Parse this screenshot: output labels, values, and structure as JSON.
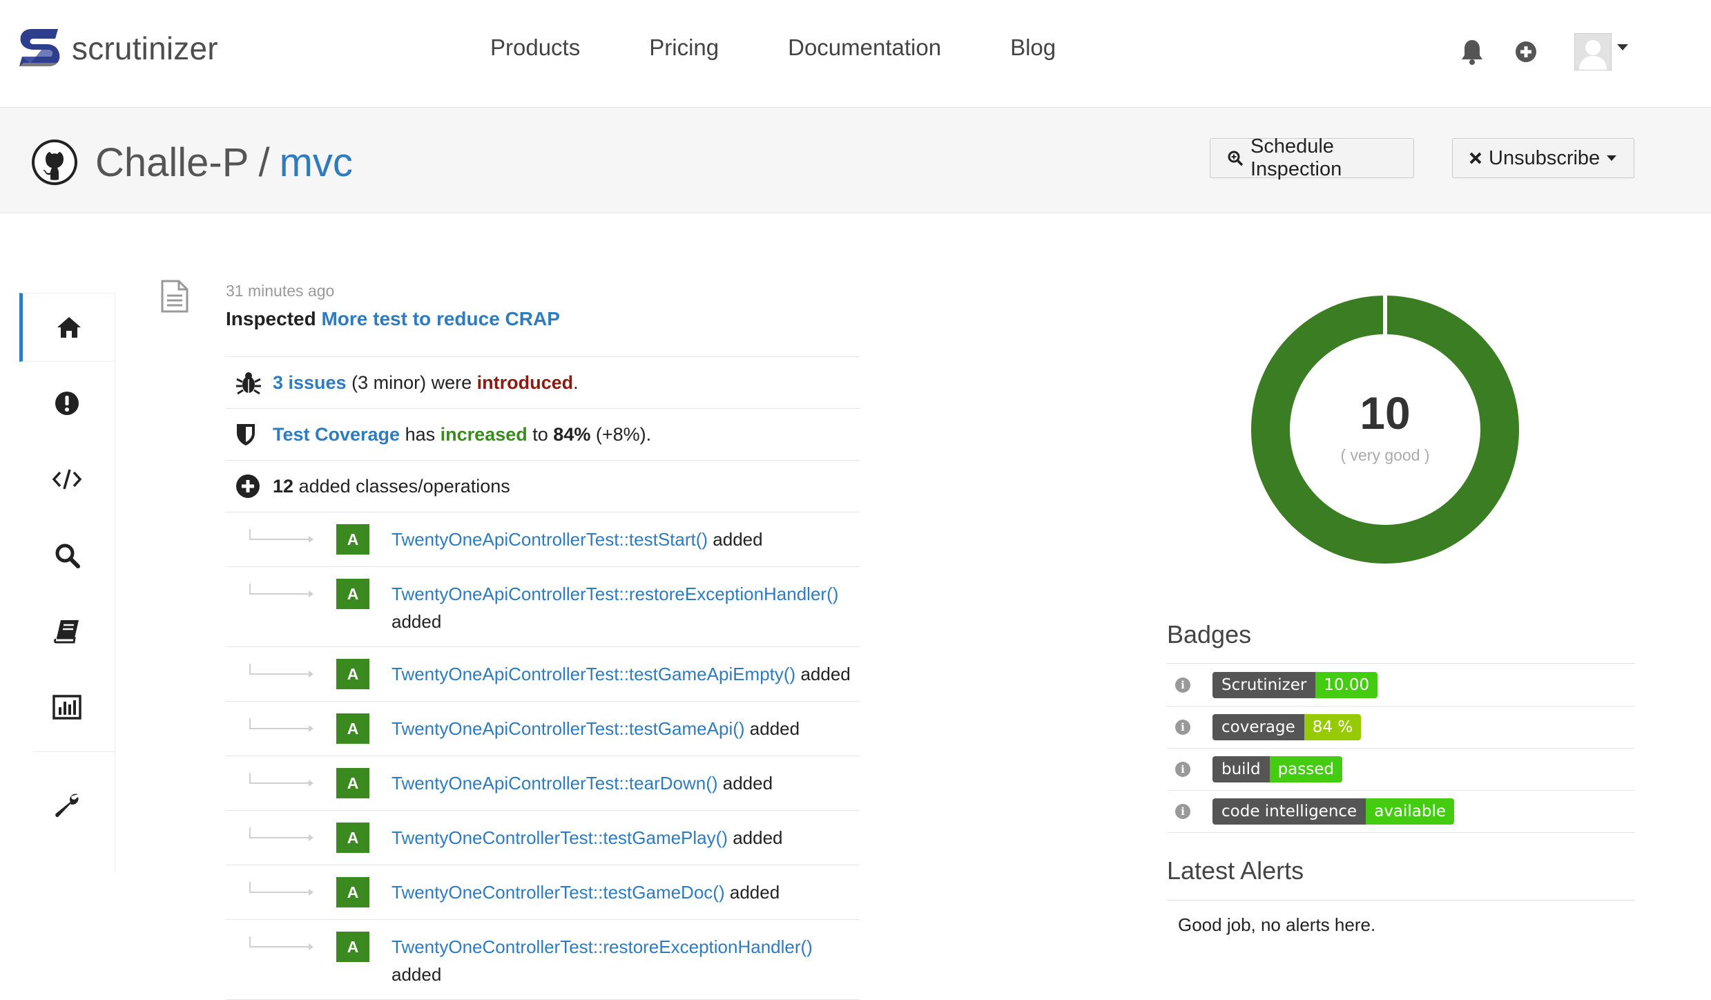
{
  "brand": {
    "name": "scrutinizer"
  },
  "nav": {
    "links": [
      "Products",
      "Pricing",
      "Documentation",
      "Blog"
    ]
  },
  "repo": {
    "owner": "Challe-P",
    "separator": "/",
    "name": "mvc",
    "schedule_label": "Schedule Inspection",
    "unsubscribe_label": "Unsubscribe"
  },
  "sidebar": {
    "items": [
      "home-icon",
      "issues-icon",
      "code-icon",
      "search-icon",
      "book-icon",
      "chart-icon",
      "wrench-icon"
    ],
    "active": "home-icon"
  },
  "inspection": {
    "time": "31 minutes ago",
    "prefix": "Inspected",
    "commit_message": "More test to reduce CRAP",
    "issues": {
      "link": "3 issues",
      "detail": "(3 minor) were",
      "status": "introduced",
      "end": "."
    },
    "coverage": {
      "link": "Test Coverage",
      "mid": "has",
      "status": "increased",
      "to": "to",
      "value": "84%",
      "delta": "(+8%)."
    },
    "added": {
      "count": "12",
      "label": "added classes/operations"
    },
    "badge_letter": "A",
    "added_word": "added",
    "operations": [
      "TwentyOneApiControllerTest::testStart()",
      "TwentyOneApiControllerTest::restoreExceptionHandler()",
      "TwentyOneApiControllerTest::testGameApiEmpty()",
      "TwentyOneApiControllerTest::testGameApi()",
      "TwentyOneApiControllerTest::tearDown()",
      "TwentyOneControllerTest::testGamePlay()",
      "TwentyOneControllerTest::testGameDoc()",
      "TwentyOneControllerTest::restoreExceptionHandler()"
    ]
  },
  "quality": {
    "score": "10",
    "label": "( very good )",
    "fraction": 1.0,
    "color": "#3a7d23"
  },
  "badges": {
    "title": "Badges",
    "items": [
      {
        "left": "Scrutinizer",
        "right": "10.00",
        "color": "#44cc11"
      },
      {
        "left": "coverage",
        "right": "84 %",
        "color": "#97ca00"
      },
      {
        "left": "build",
        "right": "passed",
        "color": "#4c1"
      },
      {
        "left": "code intelligence",
        "right": "available",
        "color": "#4c1"
      }
    ]
  },
  "alerts": {
    "title": "Latest Alerts",
    "text": "Good job, no alerts here."
  }
}
